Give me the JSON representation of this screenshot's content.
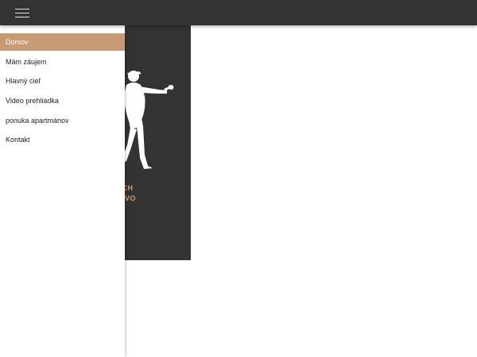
{
  "nav": {
    "items": [
      {
        "label": "Domov",
        "active": true
      },
      {
        "label": "Mám záujem",
        "active": false
      },
      {
        "label": "Hlavný cieľ",
        "active": false
      },
      {
        "label": "Video prehliadka",
        "active": false
      },
      {
        "label": "ponuka apartmánov",
        "active": false
      },
      {
        "label": "Kontakt",
        "active": false
      }
    ]
  },
  "hero": {
    "line1": "ICKÝCH",
    "line2": "AJNOVO",
    "icon": "golfer-icon"
  },
  "colors": {
    "topbar": "#333333",
    "accent": "#c89b74",
    "hero_text": "#d29a6c"
  }
}
